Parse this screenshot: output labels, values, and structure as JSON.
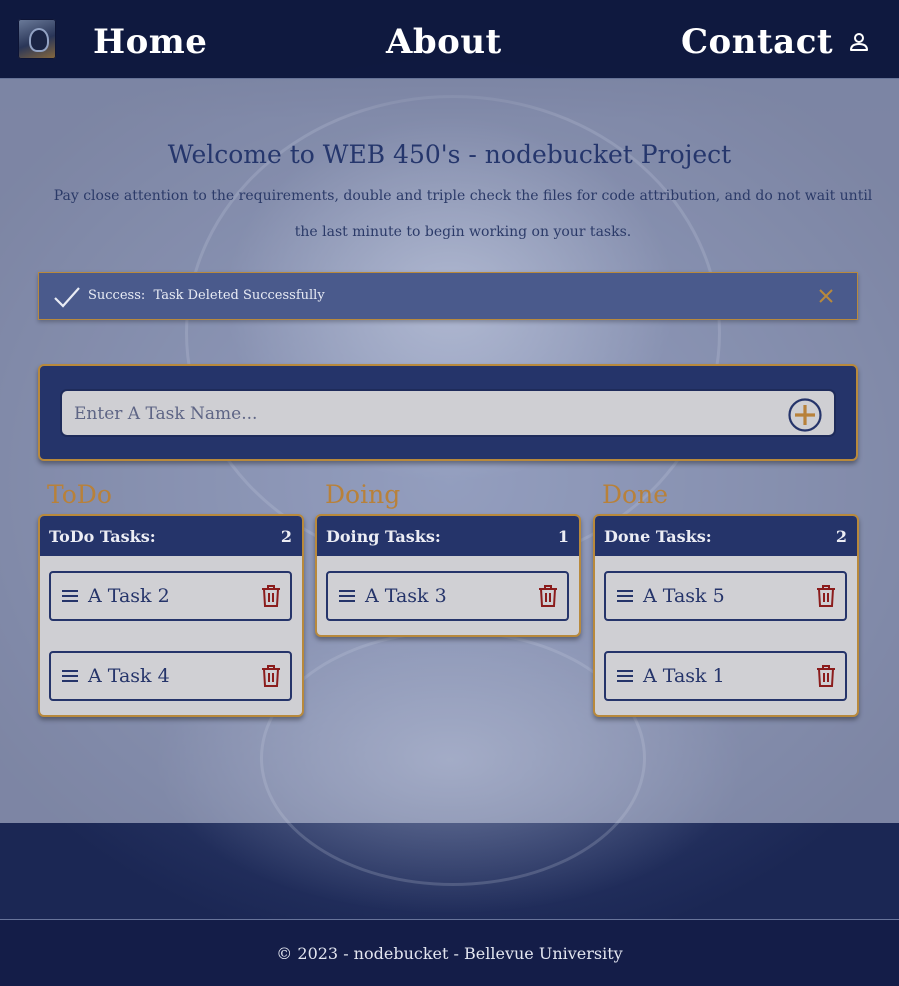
{
  "nav": {
    "links": [
      "Home",
      "About",
      "Contact"
    ]
  },
  "welcome": {
    "title": "Welcome to WEB 450's - nodebucket Project",
    "text": "Pay close attention to the requirements, double and triple check the files for code attribution, and do not wait until the last minute to begin working on your tasks."
  },
  "alert": {
    "label": "Success:",
    "message": "Task Deleted Successfully"
  },
  "task_form": {
    "placeholder": "Enter A Task Name..."
  },
  "columns": [
    {
      "heading": "ToDo",
      "header_title": "ToDo Tasks:",
      "count": "2",
      "tasks": [
        "A Task 2",
        "A Task 4"
      ]
    },
    {
      "heading": "Doing",
      "header_title": "Doing Tasks:",
      "count": "1",
      "tasks": [
        "A Task 3"
      ]
    },
    {
      "heading": "Done",
      "header_title": "Done Tasks:",
      "count": "2",
      "tasks": [
        "A Task 5",
        "A Task 1"
      ]
    }
  ],
  "footer": {
    "text": "© 2023 - nodebucket - Bellevue University"
  },
  "colors": {
    "navy": "#25346a",
    "gold": "#b8893c",
    "trash": "#8b1c1c"
  },
  "icons": {
    "logo": "logo",
    "user": "user-icon",
    "alert": "checkmark-icon",
    "close": "close-icon",
    "add": "plus-circle-icon",
    "menu": "drag-handle-icon",
    "delete": "trash-icon"
  }
}
